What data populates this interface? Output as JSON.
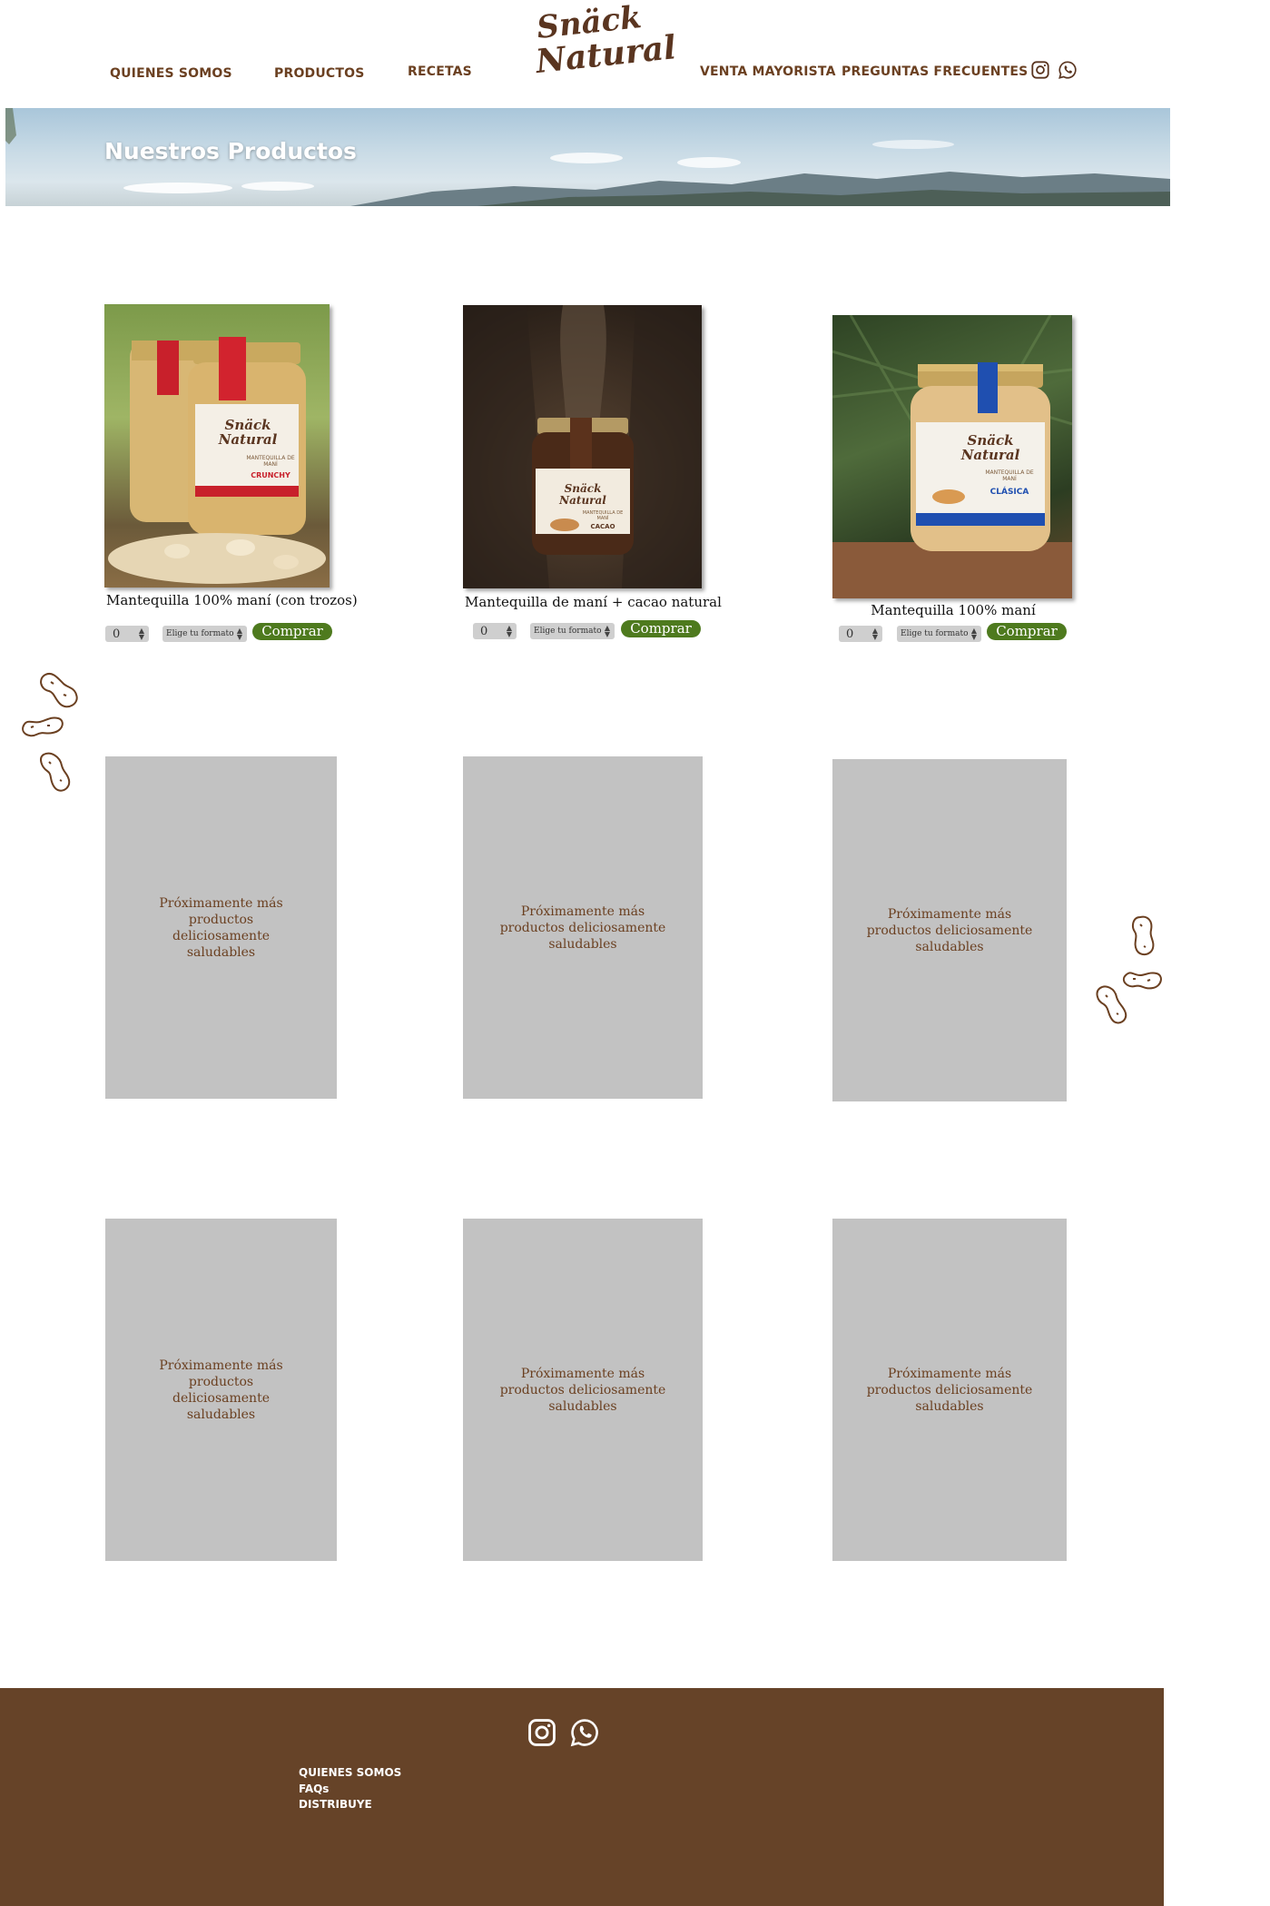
{
  "brand": {
    "logo_line1": "Snäck",
    "logo_line2": "Natural"
  },
  "nav": {
    "quienes_somos": "QUIENES SOMOS",
    "productos": "PRODUCTOS",
    "recetas": "RECETAS",
    "venta_mayorista": "VENTA MAYORISTA",
    "preguntas_frecuentes": "PREGUNTAS FRECUENTES"
  },
  "banner": {
    "title": "Nuestros Productos"
  },
  "products": [
    {
      "name": "Mantequilla 100% maní (con trozos)",
      "qty": "0",
      "format": "Elige tu formato",
      "buy": "Comprar",
      "jar_label_line1": "Snäck",
      "jar_label_line2": "Natural",
      "jar_variant": "CRUNCHY",
      "jar_type": "MANTEQUILLA DE MANÍ"
    },
    {
      "name": "Mantequilla de maní + cacao natural",
      "qty": "0",
      "format": "Elige tu formato",
      "buy": "Comprar",
      "jar_label_line1": "Snäck",
      "jar_label_line2": "Natural",
      "jar_variant": "CACAO",
      "jar_type": "MANTEQUILLA DE MANÍ"
    },
    {
      "name": "Mantequilla 100% maní",
      "qty": "0",
      "format": "Elige tu formato",
      "buy": "Comprar",
      "jar_label_line1": "Snäck",
      "jar_label_line2": "Natural",
      "jar_variant": "CLÁSICA",
      "jar_type": "MANTEQUILLA DE MANÍ"
    }
  ],
  "placeholders": {
    "row1": [
      "Próximamente más productos deliciosamente saludables",
      "Próximamente más productos deliciosamente saludables",
      "Próximamente más productos deliciosamente saludables"
    ],
    "row2": [
      "Próximamente más productos deliciosamente saludables",
      "Próximamente más productos deliciosamente saludables",
      "Próximamente más productos deliciosamente saludables"
    ]
  },
  "footer": {
    "quienes_somos": "QUIENES SOMOS",
    "faqs": "FAQs",
    "distribuye": "DISTRIBUYE"
  },
  "icons": {
    "instagram": "instagram-icon",
    "whatsapp": "whatsapp-icon",
    "peanut": "peanut-icon"
  },
  "colors": {
    "brand_brown": "#6b4021",
    "footer_bg": "#664328",
    "buy_green": "#4e7a1e",
    "placeholder_gray": "#c2c2c2"
  }
}
